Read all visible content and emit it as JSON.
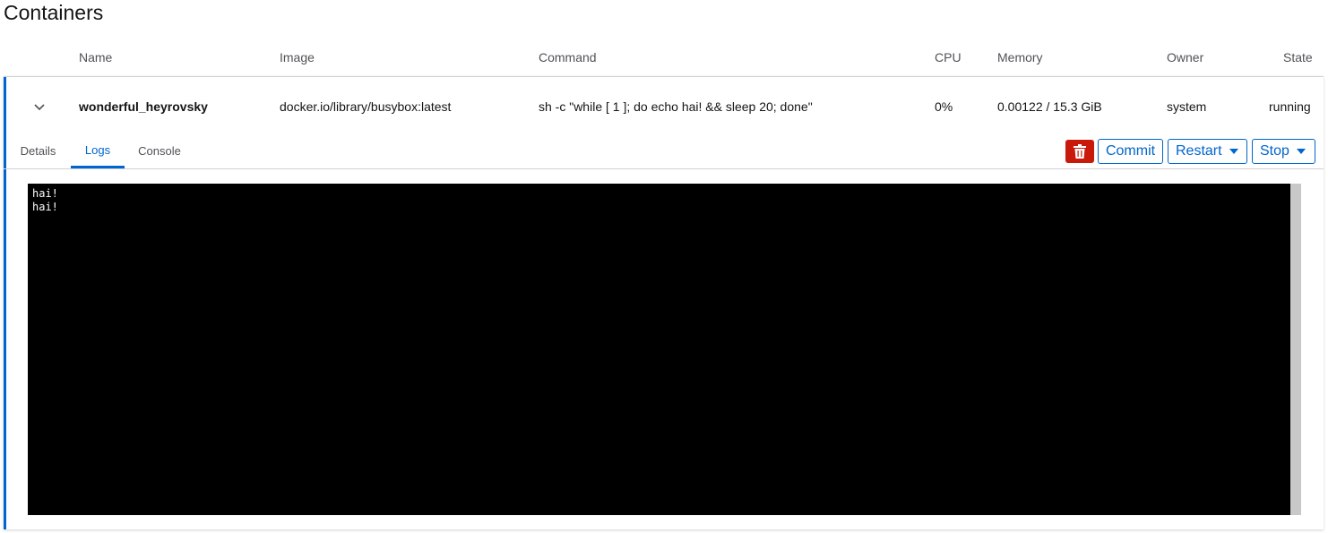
{
  "page": {
    "title": "Containers"
  },
  "table": {
    "columns": {
      "name": "Name",
      "image": "Image",
      "command": "Command",
      "cpu": "CPU",
      "memory": "Memory",
      "owner": "Owner",
      "state": "State"
    },
    "rows": [
      {
        "name": "wonderful_heyrovsky",
        "image": "docker.io/library/busybox:latest",
        "command": "sh -c \"while [ 1 ]; do echo hai! && sleep 20; done\"",
        "cpu": "0%",
        "memory": "0.00122 / 15.3 GiB",
        "owner": "system",
        "state": "running",
        "expanded": true
      }
    ]
  },
  "detail": {
    "tabs": [
      {
        "label": "Details",
        "active": false
      },
      {
        "label": "Logs",
        "active": true
      },
      {
        "label": "Console",
        "active": false
      }
    ],
    "actions": {
      "delete_icon": "trash-icon",
      "commit": "Commit",
      "restart": "Restart",
      "stop": "Stop"
    },
    "logs": {
      "lines": [
        "hai!",
        "hai!"
      ]
    }
  },
  "colors": {
    "accent": "#0066cc",
    "danger": "#c9190b",
    "terminal_bg": "#000000"
  }
}
